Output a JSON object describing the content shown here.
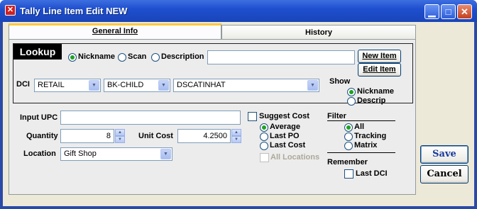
{
  "window": {
    "title": "Tally Line Item Edit NEW"
  },
  "titlebar_icons": {
    "app": "app-icon",
    "minimize": "minimize-icon",
    "maximize": "maximize-icon",
    "close": "close-icon"
  },
  "tabs": [
    {
      "label": "General Info",
      "active": true
    },
    {
      "label": "History",
      "active": false
    }
  ],
  "lookup": {
    "title": "Lookup",
    "mode_options": [
      {
        "label": "Nickname",
        "selected": true
      },
      {
        "label": "Scan",
        "selected": false
      },
      {
        "label": "Description",
        "selected": false
      }
    ],
    "search_value": "",
    "new_item_label": "New Item",
    "edit_item_label": "Edit Item",
    "dci_label": "DCI",
    "dci": {
      "department": "RETAIL",
      "category": "BK-CHILD",
      "item": "DSCATINHAT"
    },
    "show": {
      "label": "Show",
      "options": [
        {
          "label": "Nickname",
          "selected": true
        },
        {
          "label": "Descrip",
          "selected": false
        }
      ]
    }
  },
  "form": {
    "input_upc_label": "Input UPC",
    "input_upc_value": "",
    "quantity_label": "Quantity",
    "quantity_value": "8",
    "unit_cost_label": "Unit Cost",
    "unit_cost_value": "4.2500",
    "location_label": "Location",
    "location_value": "Gift Shop"
  },
  "suggest_cost": {
    "label": "Suggest Cost",
    "checked": false,
    "options": [
      {
        "label": "Average",
        "selected": true
      },
      {
        "label": "Last PO",
        "selected": false
      },
      {
        "label": "Last Cost",
        "selected": false
      }
    ],
    "all_locations_label": "All Locations"
  },
  "filter": {
    "label": "Filter",
    "options": [
      {
        "label": "All",
        "selected": true
      },
      {
        "label": "Tracking",
        "selected": false
      },
      {
        "label": "Matrix",
        "selected": false
      }
    ]
  },
  "remember": {
    "label": "Remember",
    "last_dci_label": "Last DCI",
    "checked": false
  },
  "actions": {
    "save_label": "Save",
    "cancel_label": "Cancel"
  },
  "colors": {
    "titlebar": "#1f4fcf",
    "face": "#ece9d8",
    "radio_dot": "#21a121",
    "active_tab_accent": "#ffc83d"
  }
}
